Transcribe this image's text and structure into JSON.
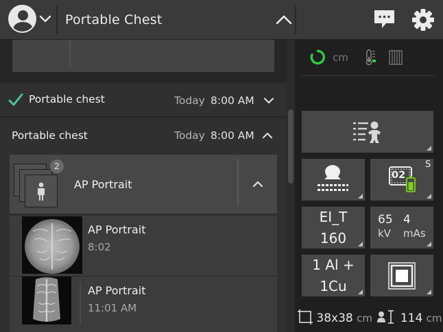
{
  "header": {
    "exam_title": "Portable Chest"
  },
  "exams": [
    {
      "label": "Portable chest",
      "status": "completed",
      "day": "Today",
      "time": "8:00 AM",
      "expanded": false
    },
    {
      "label": "Portable chest",
      "status": "active",
      "day": "Today",
      "time": "8:00 AM",
      "expanded": true
    }
  ],
  "series": {
    "label": "AP Portrait",
    "image_count": "2",
    "images": [
      {
        "label": "AP Portrait",
        "time": "8:02"
      },
      {
        "label": "AP Portrait",
        "time": "11:01 AM"
      }
    ]
  },
  "status_bar": {
    "unit": "cm"
  },
  "tiles": {
    "ei_label": "EI_T",
    "ei_value": "160",
    "kv_value": "65",
    "kv_unit": "kV",
    "mas_value": "4",
    "mas_unit": "mAs",
    "filter_line1": "1 Al +",
    "filter_line2": "1Cu",
    "detector_id": "02",
    "detector_suffix": "S"
  },
  "bottom_info": {
    "field_size": "38x38",
    "field_unit": "cm",
    "sid_value": "114",
    "sid_unit": "cm"
  },
  "colors": {
    "accent_green": "#2ecc40",
    "checkmark": "#49c4a0",
    "battery_green": "#7bd21c"
  }
}
